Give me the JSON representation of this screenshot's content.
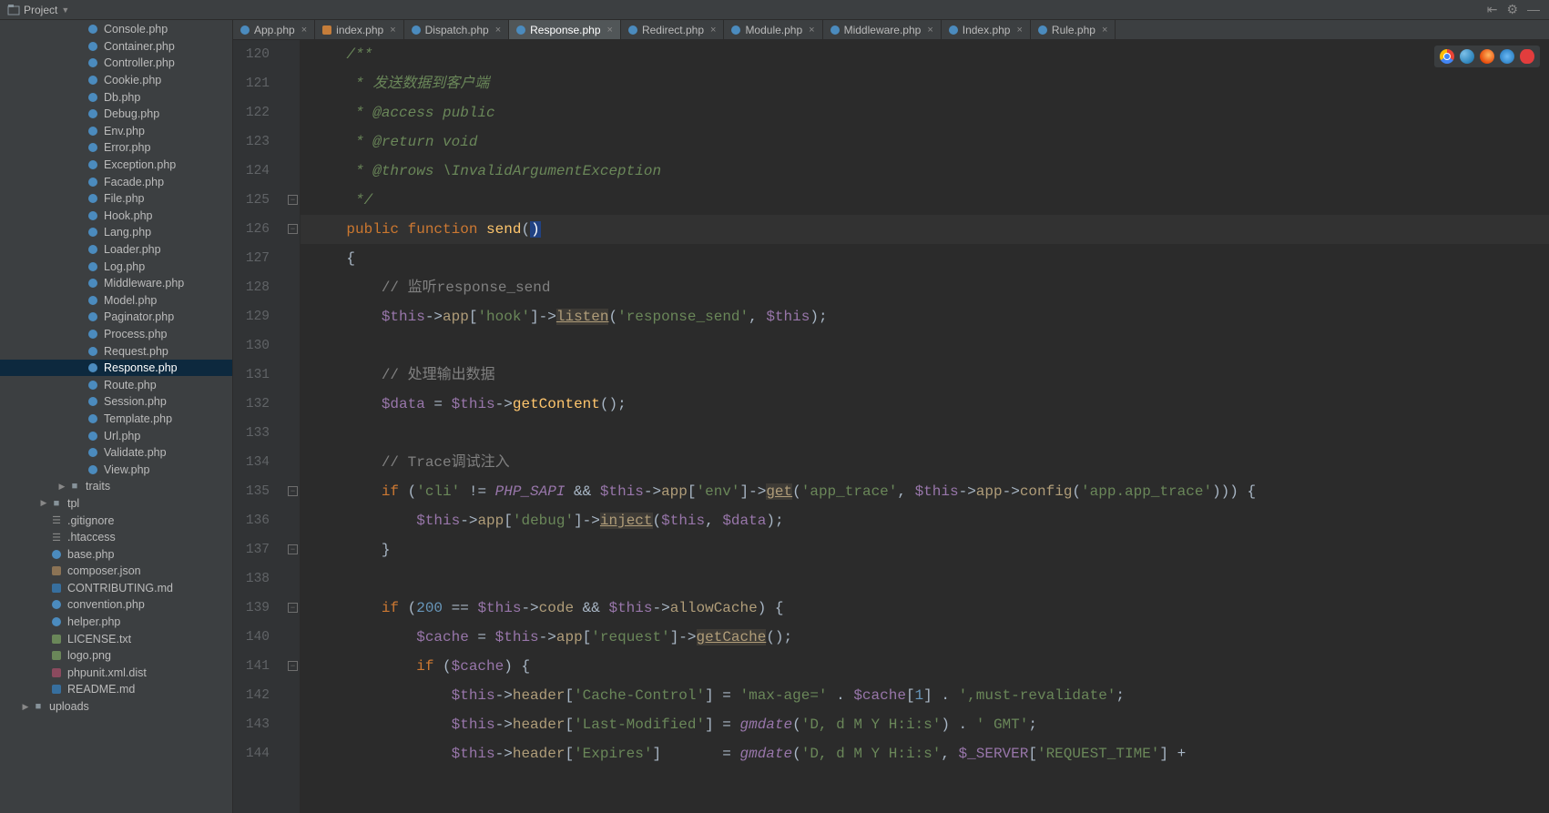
{
  "topbar": {
    "project": "Project"
  },
  "tabs": [
    {
      "label": "App.php",
      "kind": "php"
    },
    {
      "label": "index.php",
      "kind": "idx"
    },
    {
      "label": "Dispatch.php",
      "kind": "php"
    },
    {
      "label": "Response.php",
      "kind": "php",
      "active": true
    },
    {
      "label": "Redirect.php",
      "kind": "php"
    },
    {
      "label": "Module.php",
      "kind": "php"
    },
    {
      "label": "Middleware.php",
      "kind": "php"
    },
    {
      "label": "Index.php",
      "kind": "php"
    },
    {
      "label": "Rule.php",
      "kind": "php"
    }
  ],
  "tree": [
    {
      "indent": 4,
      "icon": "php",
      "label": "Console.php"
    },
    {
      "indent": 4,
      "icon": "php",
      "label": "Container.php"
    },
    {
      "indent": 4,
      "icon": "php",
      "label": "Controller.php"
    },
    {
      "indent": 4,
      "icon": "php",
      "label": "Cookie.php"
    },
    {
      "indent": 4,
      "icon": "php",
      "label": "Db.php"
    },
    {
      "indent": 4,
      "icon": "php",
      "label": "Debug.php"
    },
    {
      "indent": 4,
      "icon": "php",
      "label": "Env.php"
    },
    {
      "indent": 4,
      "icon": "php",
      "label": "Error.php"
    },
    {
      "indent": 4,
      "icon": "php",
      "label": "Exception.php"
    },
    {
      "indent": 4,
      "icon": "php",
      "label": "Facade.php"
    },
    {
      "indent": 4,
      "icon": "php",
      "label": "File.php"
    },
    {
      "indent": 4,
      "icon": "php",
      "label": "Hook.php"
    },
    {
      "indent": 4,
      "icon": "php",
      "label": "Lang.php"
    },
    {
      "indent": 4,
      "icon": "php",
      "label": "Loader.php"
    },
    {
      "indent": 4,
      "icon": "php",
      "label": "Log.php"
    },
    {
      "indent": 4,
      "icon": "php",
      "label": "Middleware.php"
    },
    {
      "indent": 4,
      "icon": "php",
      "label": "Model.php"
    },
    {
      "indent": 4,
      "icon": "php",
      "label": "Paginator.php"
    },
    {
      "indent": 4,
      "icon": "php",
      "label": "Process.php"
    },
    {
      "indent": 4,
      "icon": "php",
      "label": "Request.php"
    },
    {
      "indent": 4,
      "icon": "php",
      "label": "Response.php",
      "selected": true
    },
    {
      "indent": 4,
      "icon": "php",
      "label": "Route.php"
    },
    {
      "indent": 4,
      "icon": "php",
      "label": "Session.php"
    },
    {
      "indent": 4,
      "icon": "php",
      "label": "Template.php"
    },
    {
      "indent": 4,
      "icon": "php",
      "label": "Url.php"
    },
    {
      "indent": 4,
      "icon": "php",
      "label": "Validate.php"
    },
    {
      "indent": 4,
      "icon": "php",
      "label": "View.php"
    },
    {
      "indent": 3,
      "icon": "folder",
      "arrow": "▶",
      "label": "traits"
    },
    {
      "indent": 2,
      "icon": "folder",
      "arrow": "▶",
      "label": "tpl"
    },
    {
      "indent": 2,
      "icon": "gen",
      "label": ".gitignore"
    },
    {
      "indent": 2,
      "icon": "gen",
      "label": ".htaccess"
    },
    {
      "indent": 2,
      "icon": "php",
      "label": "base.php"
    },
    {
      "indent": 2,
      "icon": "json",
      "label": "composer.json"
    },
    {
      "indent": 2,
      "icon": "md",
      "label": "CONTRIBUTING.md"
    },
    {
      "indent": 2,
      "icon": "php",
      "label": "convention.php"
    },
    {
      "indent": 2,
      "icon": "php",
      "label": "helper.php"
    },
    {
      "indent": 2,
      "icon": "txt",
      "label": "LICENSE.txt"
    },
    {
      "indent": 2,
      "icon": "png",
      "label": "logo.png"
    },
    {
      "indent": 2,
      "icon": "xml",
      "label": "phpunit.xml.dist"
    },
    {
      "indent": 2,
      "icon": "md",
      "label": "README.md"
    },
    {
      "indent": 1,
      "icon": "folder",
      "arrow": "▶",
      "label": "uploads"
    }
  ],
  "editor": {
    "startLine": 120,
    "activeLine": 126,
    "foldMarks": [
      125,
      126,
      135,
      137,
      139,
      141
    ],
    "lines": [
      {
        "n": 120,
        "tok": [
          {
            "t": "    /**",
            "c": "doc"
          }
        ]
      },
      {
        "n": 121,
        "tok": [
          {
            "t": "     * 发送数据到客户端",
            "c": "doc"
          }
        ]
      },
      {
        "n": 122,
        "tok": [
          {
            "t": "     * @access public",
            "c": "doc"
          }
        ]
      },
      {
        "n": 123,
        "tok": [
          {
            "t": "     * @return void",
            "c": "doc"
          }
        ]
      },
      {
        "n": 124,
        "tok": [
          {
            "t": "     * @throws \\InvalidArgumentException",
            "c": "doc"
          }
        ]
      },
      {
        "n": 125,
        "tok": [
          {
            "t": "     */",
            "c": "doc"
          }
        ]
      },
      {
        "n": 126,
        "tok": [
          {
            "t": "    "
          },
          {
            "t": "public",
            "c": "keyword"
          },
          {
            "t": " "
          },
          {
            "t": "function",
            "c": "keyword2"
          },
          {
            "t": " "
          },
          {
            "t": "send",
            "c": "func"
          },
          {
            "t": "("
          },
          {
            "t": ")",
            "c": "cursor"
          }
        ]
      },
      {
        "n": 127,
        "tok": [
          {
            "t": "    {",
            "c": "op"
          }
        ]
      },
      {
        "n": 128,
        "tok": [
          {
            "t": "        "
          },
          {
            "t": "// 监听response_send",
            "c": "comment"
          }
        ]
      },
      {
        "n": 129,
        "tok": [
          {
            "t": "        "
          },
          {
            "t": "$this",
            "c": "var"
          },
          {
            "t": "->",
            "c": "op"
          },
          {
            "t": "app",
            "c": "call"
          },
          {
            "t": "[",
            "c": "op"
          },
          {
            "t": "'hook'",
            "c": "string"
          },
          {
            "t": "]->",
            "c": "op"
          },
          {
            "t": "listen",
            "c": "call-u"
          },
          {
            "t": "(",
            "c": "op"
          },
          {
            "t": "'response_send'",
            "c": "string"
          },
          {
            "t": ", ",
            "c": "op"
          },
          {
            "t": "$this",
            "c": "var"
          },
          {
            "t": ");",
            "c": "op"
          }
        ]
      },
      {
        "n": 130,
        "tok": []
      },
      {
        "n": 131,
        "tok": [
          {
            "t": "        "
          },
          {
            "t": "// 处理输出数据",
            "c": "comment"
          }
        ]
      },
      {
        "n": 132,
        "tok": [
          {
            "t": "        "
          },
          {
            "t": "$data",
            "c": "var"
          },
          {
            "t": " = ",
            "c": "op"
          },
          {
            "t": "$this",
            "c": "var"
          },
          {
            "t": "->",
            "c": "op"
          },
          {
            "t": "getContent",
            "c": "func"
          },
          {
            "t": "();",
            "c": "op"
          }
        ]
      },
      {
        "n": 133,
        "tok": []
      },
      {
        "n": 134,
        "tok": [
          {
            "t": "        "
          },
          {
            "t": "// Trace调试注入",
            "c": "comment"
          }
        ]
      },
      {
        "n": 135,
        "tok": [
          {
            "t": "        "
          },
          {
            "t": "if",
            "c": "keyword2"
          },
          {
            "t": " (",
            "c": "op"
          },
          {
            "t": "'cli'",
            "c": "string"
          },
          {
            "t": " != ",
            "c": "op"
          },
          {
            "t": "PHP_SAPI",
            "c": "const"
          },
          {
            "t": " && ",
            "c": "op"
          },
          {
            "t": "$this",
            "c": "var"
          },
          {
            "t": "->",
            "c": "op"
          },
          {
            "t": "app",
            "c": "call"
          },
          {
            "t": "[",
            "c": "op"
          },
          {
            "t": "'env'",
            "c": "string"
          },
          {
            "t": "]->",
            "c": "op"
          },
          {
            "t": "get",
            "c": "call-u"
          },
          {
            "t": "(",
            "c": "op"
          },
          {
            "t": "'app_trace'",
            "c": "string"
          },
          {
            "t": ", ",
            "c": "op"
          },
          {
            "t": "$this",
            "c": "var"
          },
          {
            "t": "->",
            "c": "op"
          },
          {
            "t": "app",
            "c": "call"
          },
          {
            "t": "->",
            "c": "op"
          },
          {
            "t": "config",
            "c": "call"
          },
          {
            "t": "(",
            "c": "op"
          },
          {
            "t": "'app.app_trace'",
            "c": "string"
          },
          {
            "t": "))) {",
            "c": "op"
          }
        ]
      },
      {
        "n": 136,
        "tok": [
          {
            "t": "            "
          },
          {
            "t": "$this",
            "c": "var"
          },
          {
            "t": "->",
            "c": "op"
          },
          {
            "t": "app",
            "c": "call"
          },
          {
            "t": "[",
            "c": "op"
          },
          {
            "t": "'debug'",
            "c": "string"
          },
          {
            "t": "]->",
            "c": "op"
          },
          {
            "t": "inject",
            "c": "call-u"
          },
          {
            "t": "(",
            "c": "op"
          },
          {
            "t": "$this",
            "c": "var"
          },
          {
            "t": ", ",
            "c": "op"
          },
          {
            "t": "$data",
            "c": "var"
          },
          {
            "t": ");",
            "c": "op"
          }
        ]
      },
      {
        "n": 137,
        "tok": [
          {
            "t": "        }",
            "c": "op"
          }
        ]
      },
      {
        "n": 138,
        "tok": []
      },
      {
        "n": 139,
        "tok": [
          {
            "t": "        "
          },
          {
            "t": "if",
            "c": "keyword2"
          },
          {
            "t": " (",
            "c": "op"
          },
          {
            "t": "200",
            "c": "num"
          },
          {
            "t": " == ",
            "c": "op"
          },
          {
            "t": "$this",
            "c": "var"
          },
          {
            "t": "->",
            "c": "op"
          },
          {
            "t": "code",
            "c": "call"
          },
          {
            "t": " && ",
            "c": "op"
          },
          {
            "t": "$this",
            "c": "var"
          },
          {
            "t": "->",
            "c": "op"
          },
          {
            "t": "allowCache",
            "c": "call"
          },
          {
            "t": ") {",
            "c": "op"
          }
        ]
      },
      {
        "n": 140,
        "tok": [
          {
            "t": "            "
          },
          {
            "t": "$cache",
            "c": "var"
          },
          {
            "t": " = ",
            "c": "op"
          },
          {
            "t": "$this",
            "c": "var"
          },
          {
            "t": "->",
            "c": "op"
          },
          {
            "t": "app",
            "c": "call"
          },
          {
            "t": "[",
            "c": "op"
          },
          {
            "t": "'request'",
            "c": "string"
          },
          {
            "t": "]->",
            "c": "op"
          },
          {
            "t": "getCache",
            "c": "call-u"
          },
          {
            "t": "();",
            "c": "op"
          }
        ]
      },
      {
        "n": 141,
        "tok": [
          {
            "t": "            "
          },
          {
            "t": "if",
            "c": "keyword2"
          },
          {
            "t": " (",
            "c": "op"
          },
          {
            "t": "$cache",
            "c": "var"
          },
          {
            "t": ") {",
            "c": "op"
          }
        ]
      },
      {
        "n": 142,
        "tok": [
          {
            "t": "                "
          },
          {
            "t": "$this",
            "c": "var"
          },
          {
            "t": "->",
            "c": "op"
          },
          {
            "t": "header",
            "c": "call"
          },
          {
            "t": "[",
            "c": "op"
          },
          {
            "t": "'Cache-Control'",
            "c": "string"
          },
          {
            "t": "] = ",
            "c": "op"
          },
          {
            "t": "'max-age='",
            "c": "string"
          },
          {
            "t": " . ",
            "c": "op"
          },
          {
            "t": "$cache",
            "c": "var"
          },
          {
            "t": "[",
            "c": "op"
          },
          {
            "t": "1",
            "c": "num"
          },
          {
            "t": "] . ",
            "c": "op"
          },
          {
            "t": "',must-revalidate'",
            "c": "string"
          },
          {
            "t": ";",
            "c": "op"
          }
        ]
      },
      {
        "n": 143,
        "tok": [
          {
            "t": "                "
          },
          {
            "t": "$this",
            "c": "var"
          },
          {
            "t": "->",
            "c": "op"
          },
          {
            "t": "header",
            "c": "call"
          },
          {
            "t": "[",
            "c": "op"
          },
          {
            "t": "'Last-Modified'",
            "c": "string"
          },
          {
            "t": "] = ",
            "c": "op"
          },
          {
            "t": "gmdate",
            "c": "const"
          },
          {
            "t": "(",
            "c": "op"
          },
          {
            "t": "'D, d M Y H:i:s'",
            "c": "string"
          },
          {
            "t": ") . ",
            "c": "op"
          },
          {
            "t": "' GMT'",
            "c": "string"
          },
          {
            "t": ";",
            "c": "op"
          }
        ]
      },
      {
        "n": 144,
        "tok": [
          {
            "t": "                "
          },
          {
            "t": "$this",
            "c": "var"
          },
          {
            "t": "->",
            "c": "op"
          },
          {
            "t": "header",
            "c": "call"
          },
          {
            "t": "[",
            "c": "op"
          },
          {
            "t": "'Expires'",
            "c": "string"
          },
          {
            "t": "]       = ",
            "c": "op"
          },
          {
            "t": "gmdate",
            "c": "const"
          },
          {
            "t": "(",
            "c": "op"
          },
          {
            "t": "'D, d M Y H:i:s'",
            "c": "string"
          },
          {
            "t": ", ",
            "c": "op"
          },
          {
            "t": "$_SERVER",
            "c": "var"
          },
          {
            "t": "[",
            "c": "op"
          },
          {
            "t": "'REQUEST_TIME'",
            "c": "string"
          },
          {
            "t": "] +",
            "c": "op"
          }
        ]
      }
    ]
  },
  "browsers": [
    "chrome",
    "edge",
    "firefox",
    "safari",
    "opera"
  ]
}
